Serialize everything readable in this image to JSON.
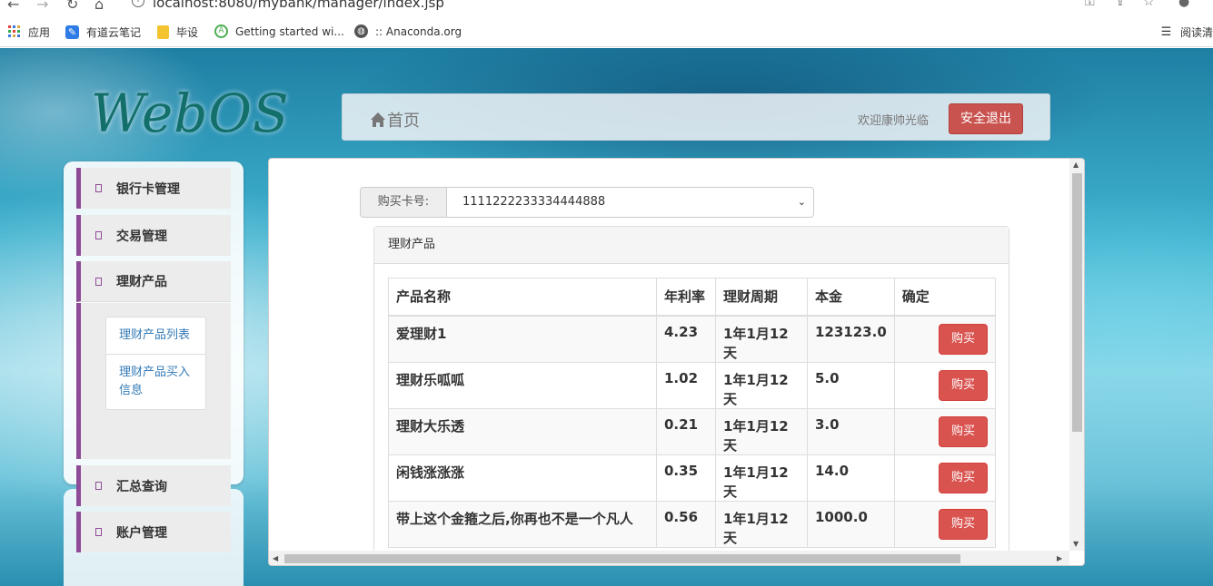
{
  "browser": {
    "url": "localhost:8080/mybank/manager/index.jsp",
    "bookmarks": [
      {
        "label": "应用",
        "icon": "apps-grid-icon"
      },
      {
        "label": "有道云笔记",
        "icon": "youdao-note-icon"
      },
      {
        "label": "毕设",
        "icon": "folder-icon"
      },
      {
        "label": "Getting started wi...",
        "icon": "android-icon"
      },
      {
        "label": ":: Anaconda.org",
        "icon": "globe-icon"
      }
    ],
    "reader_label": "阅读清"
  },
  "logo": "WebOS",
  "header": {
    "home_label": "首页",
    "welcome": "欢迎康帅光临",
    "logout_label": "安全退出"
  },
  "sidebar": {
    "items": [
      {
        "label": "银行卡管理"
      },
      {
        "label": "交易管理"
      },
      {
        "label": "理财产品"
      },
      {
        "label": "汇总查询"
      },
      {
        "label": "账户管理"
      }
    ],
    "submenu": [
      {
        "label": "理财产品列表"
      },
      {
        "label": "理财产品买入信息"
      }
    ]
  },
  "main": {
    "card_label": "购买卡号:",
    "card_value": "1111222233334444888",
    "panel_title": "理财产品",
    "columns": [
      "产品名称",
      "年利率",
      "理财周期",
      "本金",
      "确定"
    ],
    "buy_label": "购买",
    "rows": [
      {
        "name": "爱理财1",
        "rate": "4.23",
        "period": "1年1月12天",
        "principal": "123123.0"
      },
      {
        "name": "理财乐呱呱",
        "rate": "1.02",
        "period": "1年1月12天",
        "principal": "5.0"
      },
      {
        "name": "理财大乐透",
        "rate": "0.21",
        "period": "1年1月12天",
        "principal": "3.0"
      },
      {
        "name": "闲钱涨涨涨",
        "rate": "0.35",
        "period": "1年1月12天",
        "principal": "14.0"
      },
      {
        "name": "带上这个金箍之后,你再也不是一个凡人",
        "rate": "0.56",
        "period": "1年1月12天",
        "principal": "1000.0"
      }
    ]
  }
}
